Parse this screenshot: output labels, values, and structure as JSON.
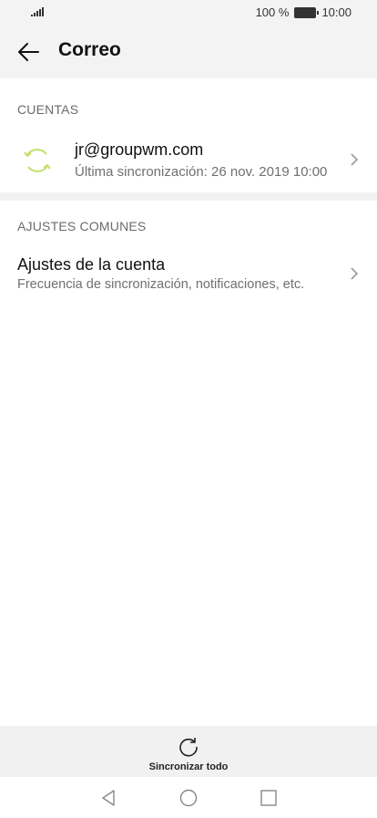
{
  "status_bar": {
    "battery_text": "100 %",
    "time": "10:00"
  },
  "header": {
    "title": "Correo"
  },
  "sections": {
    "accounts_label": "CUENTAS",
    "common_label": "AJUSTES COMUNES"
  },
  "account": {
    "email": "jr@groupwm.com",
    "last_sync": "Última sincronización: 26 nov. 2019 10:00"
  },
  "settings_item": {
    "title": "Ajustes de la cuenta",
    "subtitle": "Frecuencia de sincronización, notificaciones, etc."
  },
  "bottom_action": {
    "label": "Sincronizar todo"
  },
  "colors": {
    "sync_accent": "#c4df6c",
    "secondary_text": "#707070"
  }
}
